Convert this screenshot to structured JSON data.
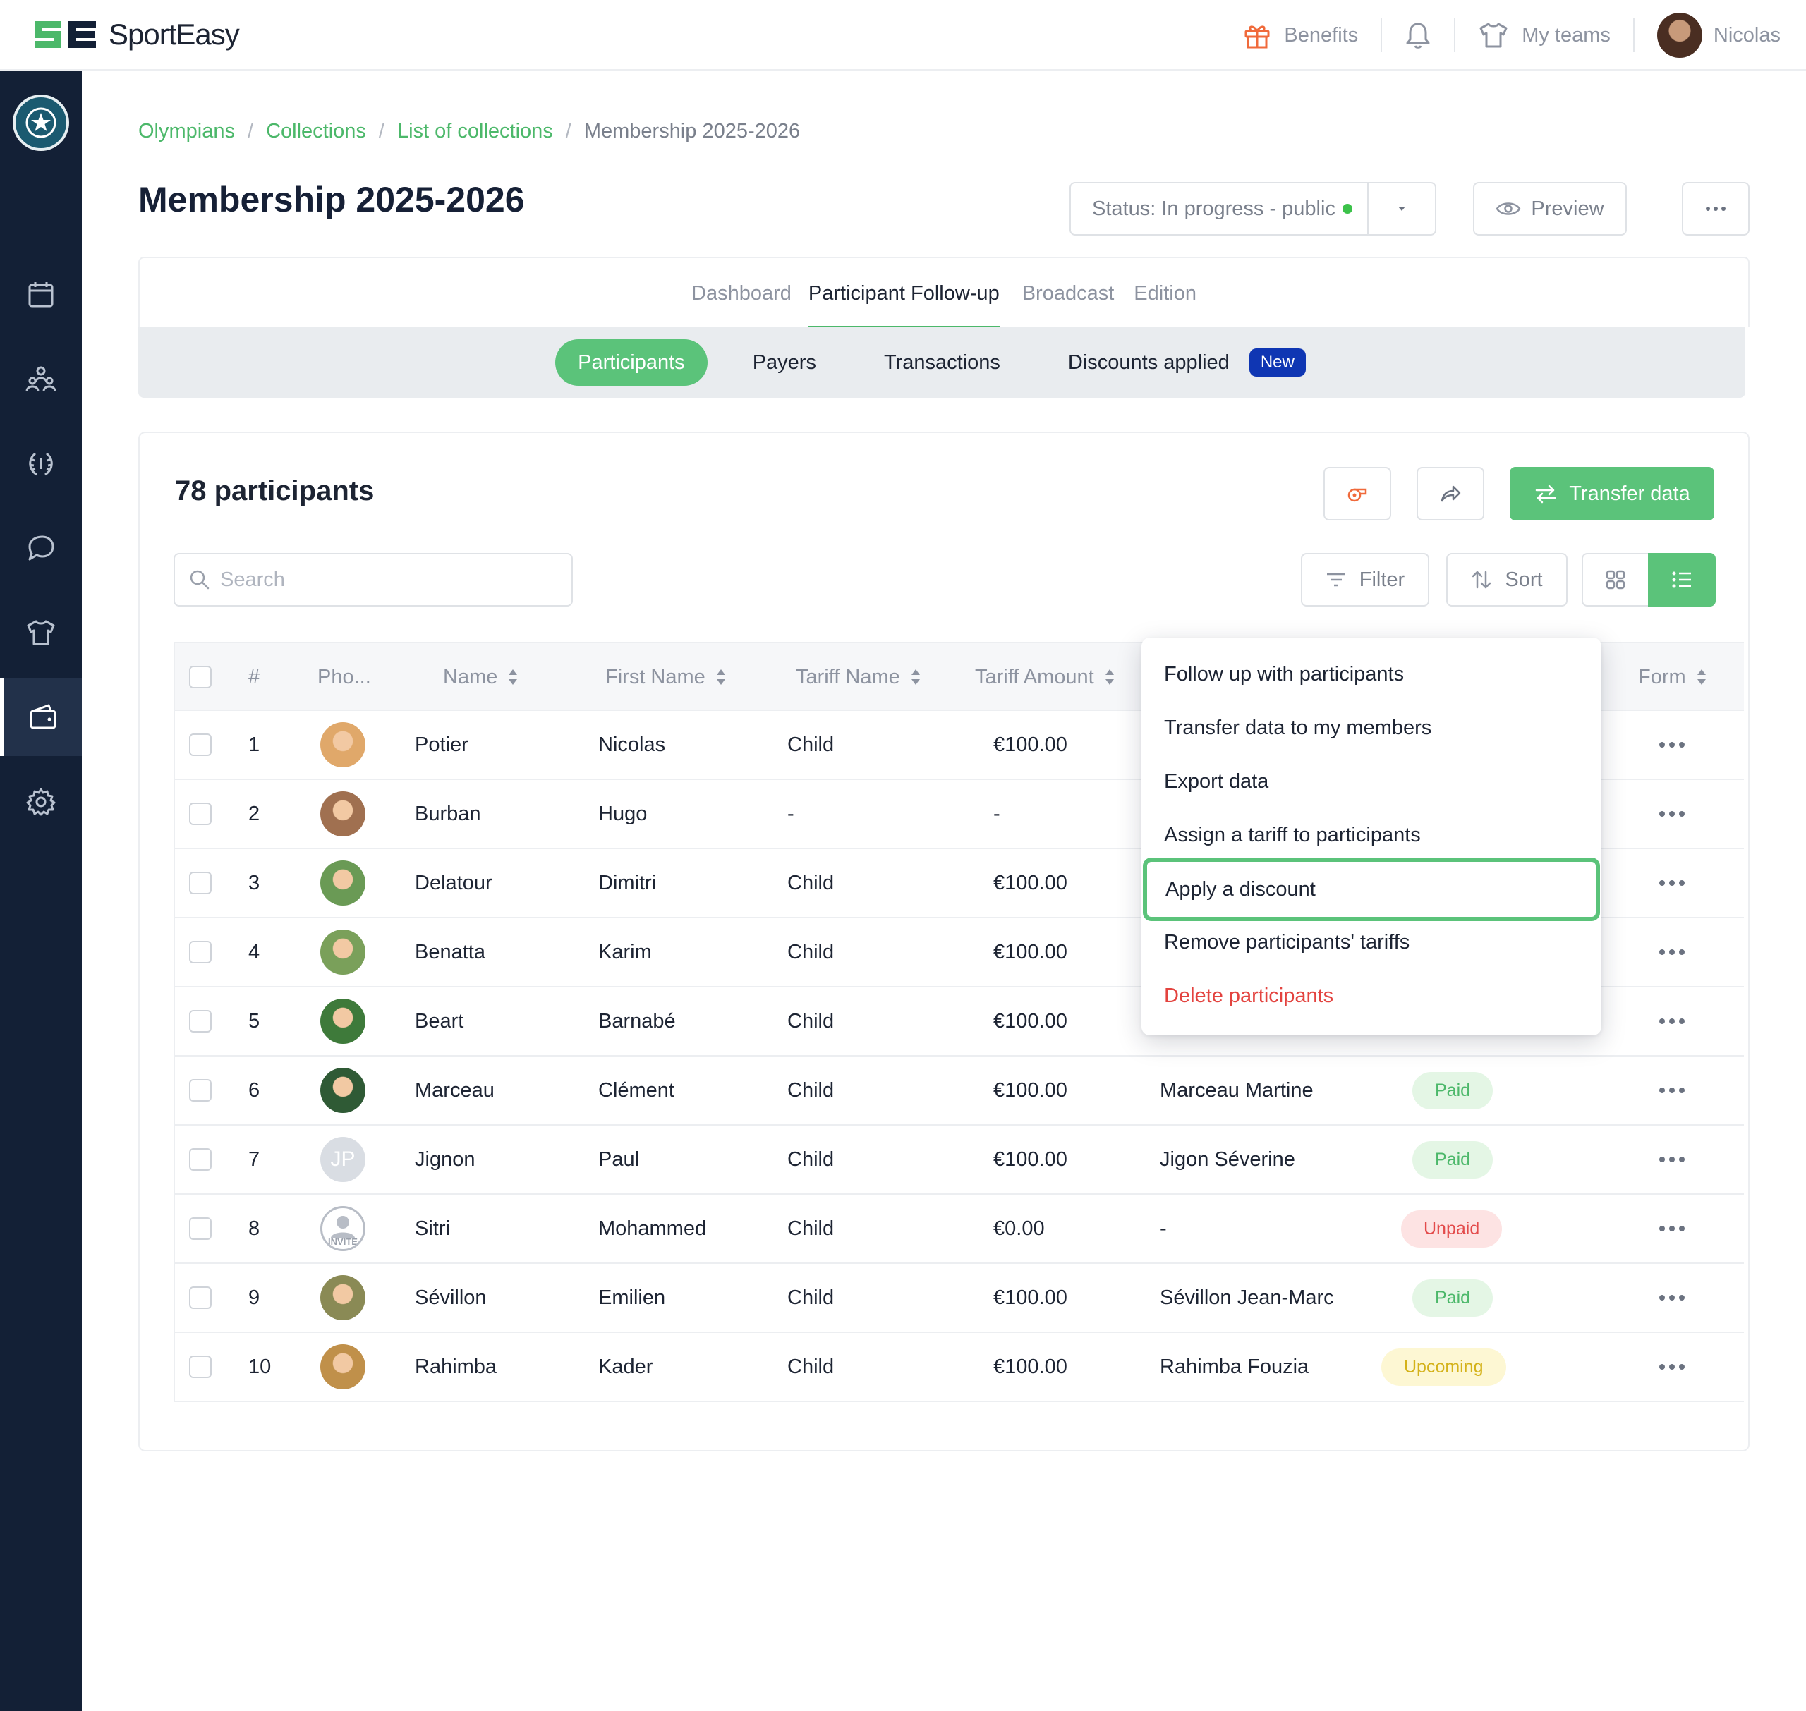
{
  "app": {
    "brand": "SportEasy",
    "brand_colors": {
      "green": "#4cb86a",
      "navy": "#132036",
      "accent_blue": "#0f36b3"
    }
  },
  "topnav": {
    "benefits": "Benefits",
    "my_teams": "My teams",
    "user": "Nicolas"
  },
  "breadcrumb": [
    "Olympians",
    "Collections",
    "List of collections",
    "Membership 2025-2026"
  ],
  "page": {
    "title": "Membership 2025-2026",
    "status": "Status: In progress - public",
    "preview": "Preview"
  },
  "main_tabs": [
    "Dashboard",
    "Participant Follow-up",
    "Broadcast",
    "Edition"
  ],
  "sub_tabs": {
    "participants": "Participants",
    "payers": "Payers",
    "transactions": "Transactions",
    "discounts": "Discounts applied",
    "new_badge": "New"
  },
  "list": {
    "count": "78 participants",
    "transfer": "Transfer data",
    "search_placeholder": "Search",
    "filter": "Filter",
    "sort": "Sort"
  },
  "table": {
    "headers": {
      "num": "#",
      "photo": "Pho...",
      "name": "Name",
      "first": "First Name",
      "tariff": "Tariff Name",
      "amount": "Tariff Amount",
      "form": "Form"
    },
    "rows": [
      {
        "n": "1",
        "name": "Potier",
        "first": "Nicolas",
        "tariff": "Child",
        "amount": "€100.00",
        "payer": "",
        "status": "",
        "status_kind": "",
        "avatar": "#e0a86a"
      },
      {
        "n": "2",
        "name": "Burban",
        "first": "Hugo",
        "tariff": "-",
        "amount": "-",
        "payer": "",
        "status": "",
        "status_kind": "",
        "avatar": "#a07050"
      },
      {
        "n": "3",
        "name": "Delatour",
        "first": "Dimitri",
        "tariff": "Child",
        "amount": "€100.00",
        "payer": "",
        "status": "",
        "status_kind": "",
        "avatar": "#6a9a55"
      },
      {
        "n": "4",
        "name": "Benatta",
        "first": "Karim",
        "tariff": "Child",
        "amount": "€100.00",
        "payer": "",
        "status": "",
        "status_kind": "",
        "avatar": "#7aa05a"
      },
      {
        "n": "5",
        "name": "Beart",
        "first": "Barnabé",
        "tariff": "Child",
        "amount": "€100.00",
        "payer": "",
        "status": "",
        "status_kind": "",
        "avatar": "#3e7a3a"
      },
      {
        "n": "6",
        "name": "Marceau",
        "first": "Clément",
        "tariff": "Child",
        "amount": "€100.00",
        "payer": "Marceau Martine",
        "status": "Paid",
        "status_kind": "paid",
        "avatar": "#2f5a35"
      },
      {
        "n": "7",
        "name": "Jignon",
        "first": "Paul",
        "tariff": "Child",
        "amount": "€100.00",
        "payer": "Jigon Séverine",
        "status": "Paid",
        "status_kind": "paid",
        "avatar": "initials",
        "initials": "JP"
      },
      {
        "n": "8",
        "name": "Sitri",
        "first": "Mohammed",
        "tariff": "Child",
        "amount": "€0.00",
        "payer": "-",
        "status": "Unpaid",
        "status_kind": "unpaid",
        "avatar": "invite",
        "invite": "INVITE"
      },
      {
        "n": "9",
        "name": "Sévillon",
        "first": "Emilien",
        "tariff": "Child",
        "amount": "€100.00",
        "payer": "Sévillon Jean-Marc",
        "status": "Paid",
        "status_kind": "paid",
        "avatar": "#8a8a55"
      },
      {
        "n": "10",
        "name": "Rahimba",
        "first": "Kader",
        "tariff": "Child",
        "amount": "€100.00",
        "payer": "Rahimba Fouzia",
        "status": "Upcoming",
        "status_kind": "upcoming",
        "avatar": "#c0904a"
      }
    ]
  },
  "menu": {
    "items": [
      "Follow up with participants",
      "Transfer data to my members",
      "Export data",
      "Assign a tariff to participants",
      "Apply a discount",
      "Remove participants' tariffs",
      "Delete participants"
    ]
  }
}
